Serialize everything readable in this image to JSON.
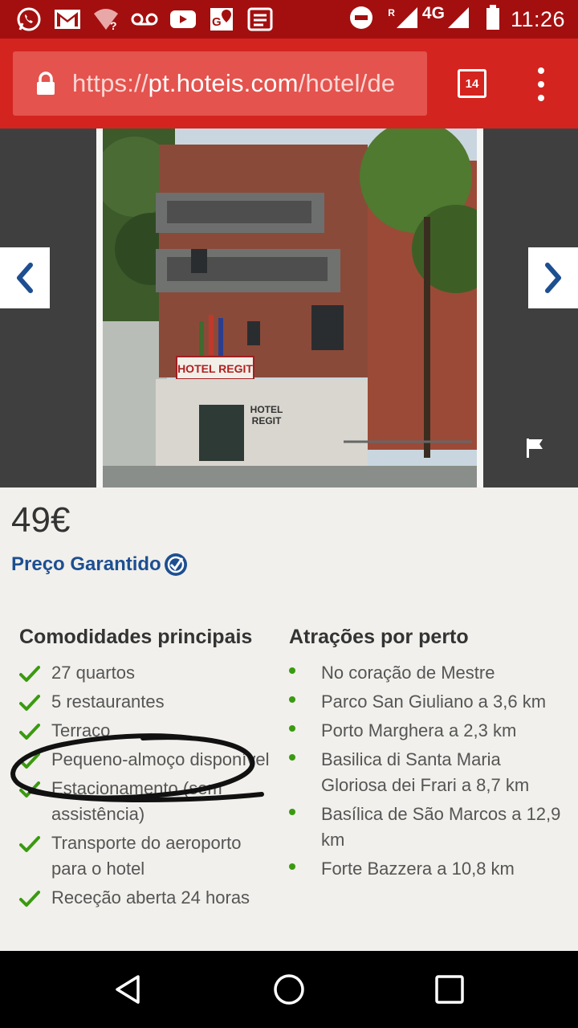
{
  "status_bar": {
    "time": "11:26",
    "network": "4G",
    "roaming": "R",
    "left_icons": [
      "whatsapp-icon",
      "gmail-icon",
      "wifi-question-icon",
      "voicemail-icon",
      "youtube-icon",
      "maps-icon",
      "news-icon"
    ],
    "right_icons": [
      "do-not-disturb-icon",
      "signal-icon",
      "battery-icon"
    ]
  },
  "browser": {
    "url_scheme": "https://",
    "url_domain": "pt.hoteis.com",
    "url_path": "/hotel/de",
    "tab_count": "14"
  },
  "gallery": {
    "sign_text": "HOTEL REGIT",
    "plaque_line1": "HOTEL",
    "plaque_line2": "REGIT"
  },
  "listing": {
    "price": "49€",
    "guarantee": "Preço Garantido"
  },
  "amenities": {
    "title": "Comodidades principais",
    "items": [
      "27 quartos",
      "5 restaurantes",
      "Terraço",
      "Pequeno-almoço disponível",
      "Estacionamento (sem assistência)",
      "Transporte do aeroporto para o hotel",
      "Receção aberta 24 horas"
    ]
  },
  "attractions": {
    "title": "Atrações por perto",
    "items": [
      "No coração de Mestre",
      "Parco San Giuliano a 3,6 km",
      "Porto Marghera a 2,3 km",
      "Basilica di Santa Maria Gloriosa dei Frari a 8,7 km",
      "Basílica de São Marcos a 12,9 km",
      "Forte Bazzera a 10,8 km"
    ]
  },
  "colors": {
    "toolbar": "#d4241f",
    "statusbar": "#a30f0f",
    "brand_blue": "#1d4f91",
    "check_green": "#3a9a10"
  }
}
